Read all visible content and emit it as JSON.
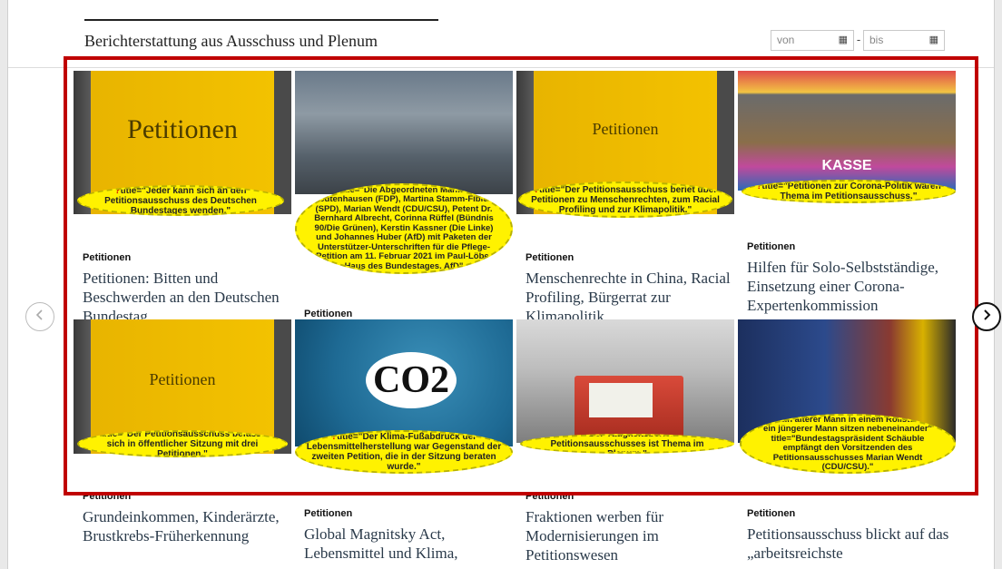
{
  "header": {
    "title": "Berichterstattung aus Ausschuss und Plenum",
    "date_from_placeholder": "von",
    "date_to_placeholder": "bis",
    "date_separator": "-"
  },
  "navigation": {
    "prev_icon": "chevron-left-icon",
    "next_icon": "chevron-right-icon"
  },
  "colors": {
    "highlight_frame": "#c00000",
    "annotation_bubble": "#fff200",
    "annotation_marker": "#d40000"
  },
  "tiles": [
    {
      "image_word": "Petitionen",
      "annotation": "title=\"Jeder kann sich an den Petitionsausschuss des Deutschen Bundestages wenden.\"",
      "kicker": "Petitionen",
      "title": "Petitionen: Bitten und Beschwerden an den Deutschen Bundestag"
    },
    {
      "annotation": "title=\"Die Abgeordneten Manfred Todtenhausen (FDP), Martina Stamm-Fibich (SPD), Marian Wendt (CDU/CSU), Petent Dr. Bernhard Albrecht, Corinna Rüffel (Bündnis 90/Die Grünen), Kerstin Kassner (Die Linke) und Johannes Huber (AfD) mit Paketen der Unterstützer-Unterschriften für die Pflege-Petition am 11. Februar 2021 im Paul-Löbe-Haus des Bundestages. AfD\"",
      "kicker": "Petitionen",
      "title": ""
    },
    {
      "image_word": "Petitionen",
      "annotation": "title=\"Der Petitionsausschuss beriet über Petitionen zu Menschenrechten, zum Racial Profiling und zur Klimapolitik.\"",
      "kicker": "Petitionen",
      "title": "Menschenrechte in China, Racial Profiling, Bürgerrat zur Klimapolitik"
    },
    {
      "image_word": "KASSE",
      "annotation": "title=\"Petitionen zur Corona-Politik waren Thema im Petitionsausschuss.\"",
      "kicker": "Petitionen",
      "title": "Hilfen für Solo-Selbstständige, Einsetzung einer Corona-Expertenkommission"
    },
    {
      "image_word": "Petitionen",
      "annotation": "title=\"Der Petitionsausschuss befasste sich in öffentlicher Sitzung mit drei Petitionen.\"",
      "kicker": "Petitionen",
      "title": "Grundeinkommen, Kinderärzte, Brustkrebs-Früherkennung"
    },
    {
      "image_word": "CO2",
      "annotation": "title=\"Der Klima-Fußabdruck der Lebensmittelherstellung war Gegenstand der zweiten Petition, die in der Sitzung beraten wurde.\"",
      "kicker": "Petitionen",
      "title": "Global Magnitsky Act, Lebensmittel und Klima,"
    },
    {
      "annotation": "title=\"Der Tätigkeitsbericht des Petitionsausschusses ist Thema im Plenum.\"",
      "kicker": "Petitionen",
      "title": "Fraktionen werben für Modernisierungen im Petitionswesen"
    },
    {
      "annotation": "alt=\"Ein älterer Mann in einem Rollstuhl und ein jüngerer Mann sitzen nebeneinander\" title=\"Bundestagspräsident Schäuble empfängt den Vorsitzenden des Petitionsausschusses Marian Wendt (CDU/CSU).\"",
      "kicker": "Petitionen",
      "title": "Petitionsausschuss blickt auf das „arbeitsreichste"
    }
  ]
}
